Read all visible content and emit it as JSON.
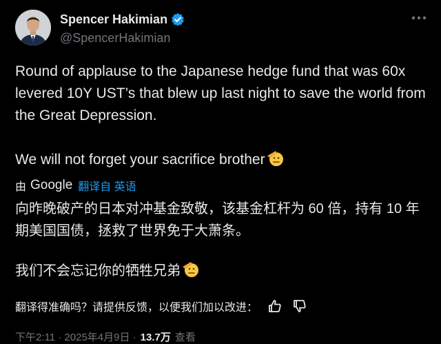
{
  "author": {
    "name": "Spencer Hakimian",
    "handle": "@SpencerHakimian",
    "verified": true
  },
  "tweet": {
    "paragraph1": "Round of applause to the Japanese hedge fund that was 60x levered 10Y UST’s that blew up last night to save the world from the Great Depression.",
    "paragraph2": "We will not forget your sacrifice brother",
    "emoji": "saluting-face"
  },
  "translation": {
    "by_label": "由",
    "provider": "Google",
    "link_label": "翻译自 英语",
    "paragraph1": "向昨晚破产的日本对冲基金致敬，该基金杠杆为 60 倍，持有 10 年期美国国债，拯救了世界免于大萧条。",
    "paragraph2": "我们不会忘记你的牺牲兄弟"
  },
  "feedback": {
    "prompt": "翻译得准确吗？请提供反馈，以便我们加以改进：",
    "thumbs_up_icon": "thumbs-up-icon",
    "thumbs_down_icon": "thumbs-down-icon"
  },
  "footer": {
    "time_date": "下午2:11 · 2025年4月9日 ·",
    "views_count": "13.7万",
    "views_label": "查看"
  },
  "colors": {
    "background": "#000000",
    "text": "#e7e9ea",
    "muted": "#71767b",
    "accent": "#1d9bf0"
  }
}
